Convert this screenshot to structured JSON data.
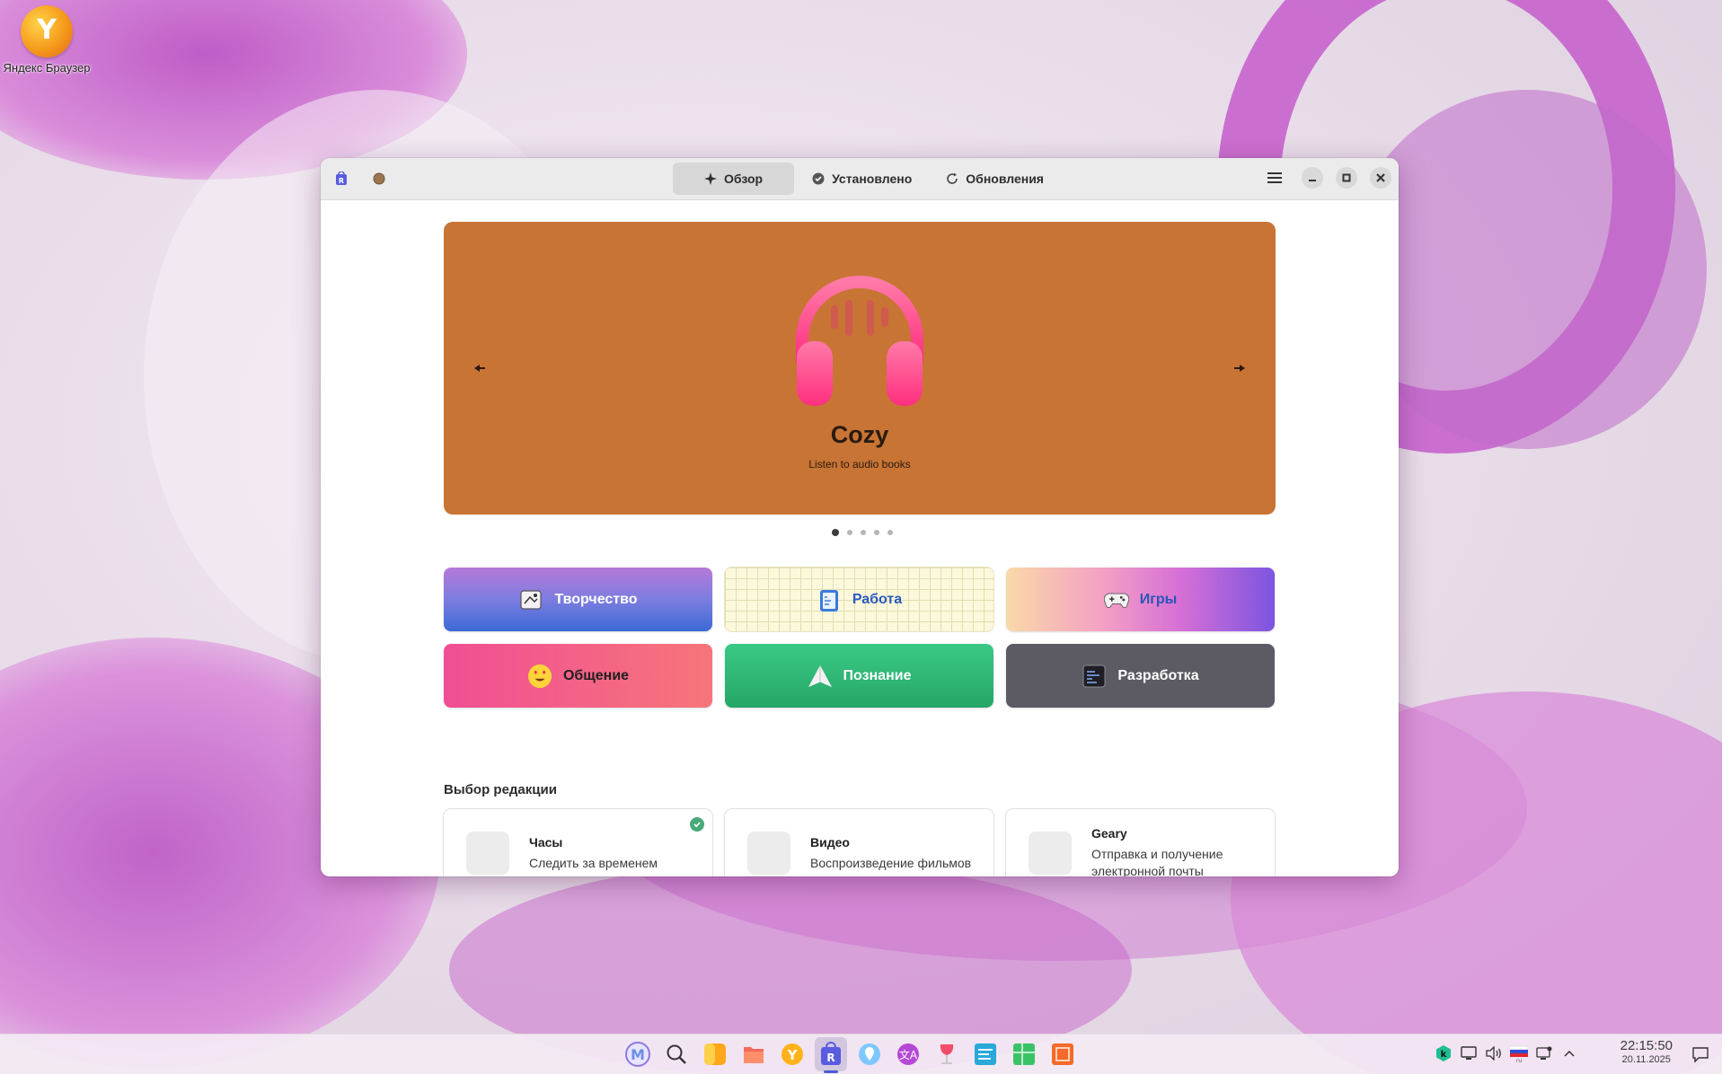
{
  "desktop": {
    "icons": [
      {
        "label": "Яндекс Браузер",
        "icon": "yandex-browser-icon"
      }
    ]
  },
  "window": {
    "tabs": [
      {
        "label": "Обзор",
        "icon": "sparkle-icon",
        "active": true
      },
      {
        "label": "Установлено",
        "icon": "check-circle-icon",
        "active": false
      },
      {
        "label": "Обновления",
        "icon": "refresh-icon",
        "active": false
      }
    ],
    "left_icons": [
      "app-store-icon",
      "avatar-icon"
    ],
    "controls": [
      "menu-icon",
      "minimize-icon",
      "maximize-icon",
      "close-icon"
    ]
  },
  "banner": {
    "app_name": "Cozy",
    "description": "Listen to audio books",
    "background": "#c87434",
    "dots": 5,
    "active_dot": 0
  },
  "categories": [
    {
      "label": "Творчество",
      "key": "create",
      "icon": "palette-icon"
    },
    {
      "label": "Работа",
      "key": "work",
      "icon": "clipboard-icon"
    },
    {
      "label": "Игры",
      "key": "games",
      "icon": "gamepad-icon"
    },
    {
      "label": "Общение",
      "key": "social",
      "icon": "emoji-icon"
    },
    {
      "label": "Познание",
      "key": "learn",
      "icon": "paper-plane-icon"
    },
    {
      "label": "Разработка",
      "key": "dev",
      "icon": "terminal-icon"
    }
  ],
  "editors_choice": {
    "title": "Выбор редакции",
    "items": [
      {
        "name": "Часы",
        "desc": "Следить за временем",
        "installed": true
      },
      {
        "name": "Видео",
        "desc": "Воспроизведение фильмов",
        "installed": false
      },
      {
        "name": "Geary",
        "desc": "Отправка и получение электронной почты",
        "installed": false
      }
    ]
  },
  "taskbar": {
    "apps": [
      "launcher-icon",
      "search-icon",
      "notes-icon",
      "files-icon",
      "yandex-browser-icon",
      "app-store-icon",
      "maps-icon",
      "translate-icon",
      "wine-icon",
      "text-editor-icon",
      "spreadsheet-icon",
      "presentation-icon"
    ],
    "active_app": "app-store-icon",
    "tray": [
      "kaspersky-icon",
      "display-icon",
      "volume-icon",
      "flag-ru-icon",
      "network-icon",
      "chevron-up-icon"
    ],
    "keyboard_layout": "ru",
    "time": "22:15:50",
    "date": "20.11.2025"
  }
}
